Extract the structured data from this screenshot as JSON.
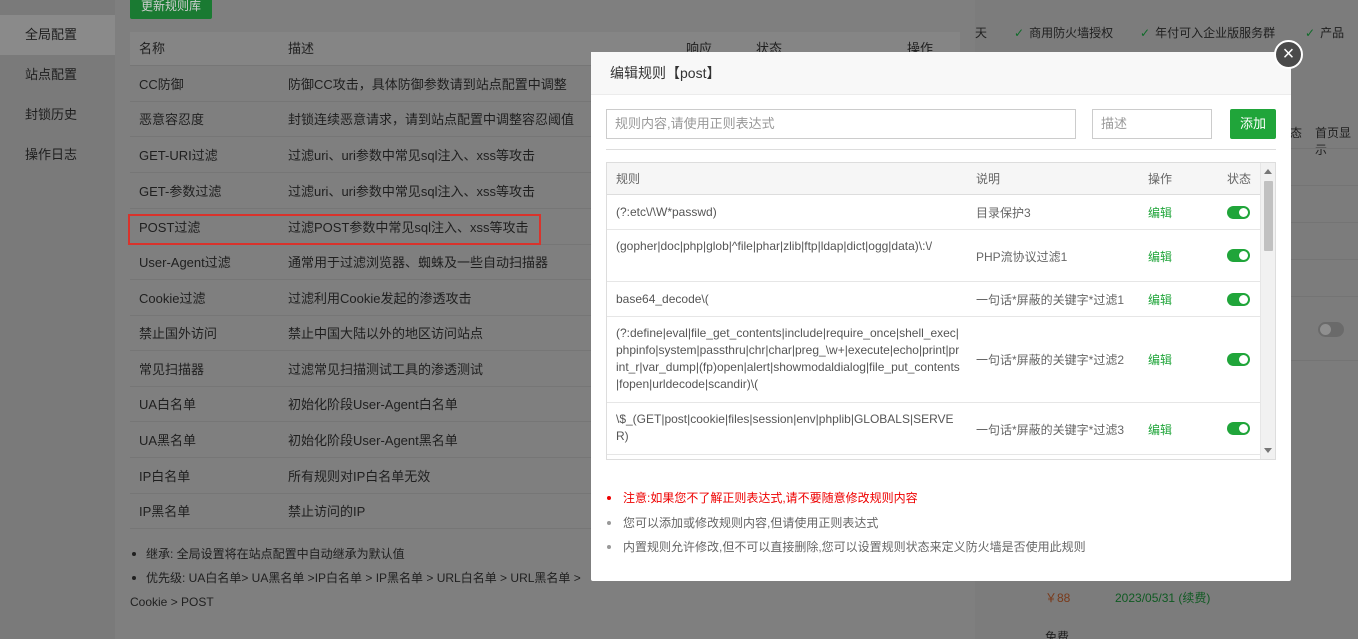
{
  "sidebar": {
    "items": [
      {
        "label": "全局配置",
        "active": true
      },
      {
        "label": "站点配置"
      },
      {
        "label": "封锁历史"
      },
      {
        "label": "操作日志"
      }
    ]
  },
  "background": {
    "update_button": "更新规则库",
    "table_headers": [
      "名称",
      "描述",
      "响应",
      "状态",
      "操作"
    ],
    "rows": [
      {
        "name": "CC防御",
        "desc": "防御CC攻击，具体防御参数请到站点配置中调整"
      },
      {
        "name": "恶意容忍度",
        "desc": "封锁连续恶意请求，请到站点配置中调整容忍阈值"
      },
      {
        "name": "GET-URI过滤",
        "desc": "过滤uri、uri参数中常见sql注入、xss等攻击"
      },
      {
        "name": "GET-参数过滤",
        "desc": "过滤uri、uri参数中常见sql注入、xss等攻击"
      },
      {
        "name": "POST过滤",
        "desc": "过滤POST参数中常见sql注入、xss等攻击"
      },
      {
        "name": "User-Agent过滤",
        "desc": "通常用于过滤浏览器、蜘蛛及一些自动扫描器"
      },
      {
        "name": "Cookie过滤",
        "desc": "过滤利用Cookie发起的渗透攻击"
      },
      {
        "name": "禁止国外访问",
        "desc": "禁止中国大陆以外的地区访问站点"
      },
      {
        "name": "常见扫描器",
        "desc": "过滤常见扫描测试工具的渗透测试"
      },
      {
        "name": "UA白名单",
        "desc": "初始化阶段User-Agent白名单"
      },
      {
        "name": "UA黑名单",
        "desc": "初始化阶段User-Agent黑名单"
      },
      {
        "name": "IP白名单",
        "desc": "所有规则对IP白名单无效"
      },
      {
        "name": "IP黑名单",
        "desc": "禁止访问的IP"
      }
    ],
    "notes": [
      "继承: 全局设置将在站点配置中自动继承为默认值",
      "优先级: UA白名单> UA黑名单 >IP白名单 > IP黑名单 > URL白名单 > URL黑名单 >",
      "Cookie > POST"
    ],
    "right_panel": {
      "features": [
        "天",
        "商用防火墙授权",
        "年付可入企业版服务群",
        "产品"
      ],
      "tabs": [
        "态",
        "首页显示"
      ],
      "price": "￥88",
      "date": "2023/05/31",
      "renew": "(续费)",
      "free": "免费"
    }
  },
  "modal": {
    "title": "编辑规则【post】",
    "rule_placeholder": "规则内容,请使用正则表达式",
    "desc_placeholder": "描述",
    "add_button": "添加",
    "columns": {
      "rule": "规则",
      "desc": "说明",
      "op": "操作",
      "status": "状态"
    },
    "rows": [
      {
        "rule": "(?:etc\\/\\W*passwd)",
        "desc": "目录保护3",
        "op": "编辑",
        "enabled": true
      },
      {
        "rule": "(gopher|doc|php|glob|^file|phar|zlib|ftp|ldap|dict|ogg|data)\\:\\/",
        "desc": "PHP流协议过滤1",
        "op": "编辑",
        "enabled": true
      },
      {
        "rule": "base64_decode\\(",
        "desc": "一句话*屏蔽的关键字*过滤1",
        "op": "编辑",
        "enabled": true
      },
      {
        "rule": "(?:define|eval|file_get_contents|include|require_once|shell_exec|phpinfo|system|passthru|chr|char|preg_\\w+|execute|echo|print|print_r|var_dump|(fp)open|alert|showmodaldialog|file_put_contents|fopen|urldecode|scandir)\\(",
        "desc": "一句话*屏蔽的关键字*过滤2",
        "op": "编辑",
        "enabled": true
      },
      {
        "rule": "\\$_(GET|post|cookie|files|session|env|phplib|GLOBALS|SERVER)",
        "desc": "一句话*屏蔽的关键字*过滤3",
        "op": "编辑",
        "enabled": true
      }
    ],
    "tips": [
      "注意:如果您不了解正则表达式,请不要随意修改规则内容",
      "您可以添加或修改规则内容,但请使用正则表达式",
      "内置规则允许修改,但不可以直接删除,您可以设置规则状态来定义防火墙是否使用此规则"
    ],
    "close_glyph": "×"
  },
  "colors": {
    "accent": "#20a53a",
    "warn": "#ee0000",
    "highlight": "#d9332c"
  }
}
